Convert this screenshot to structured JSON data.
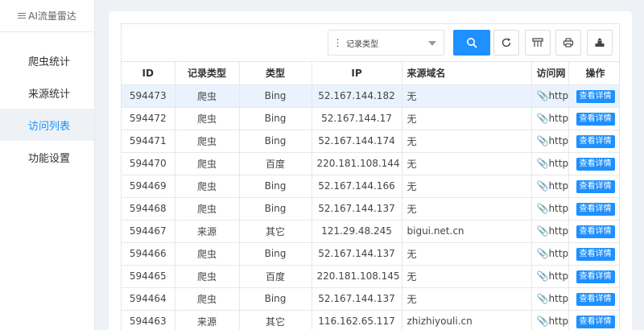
{
  "brand": {
    "title": "AI流量雷达"
  },
  "sidebar": {
    "items": [
      {
        "label": "爬虫统计",
        "active": false
      },
      {
        "label": "来源统计",
        "active": false
      },
      {
        "label": "访问列表",
        "active": true
      },
      {
        "label": "功能设置",
        "active": false
      }
    ]
  },
  "toolbar": {
    "select_value": "记录类型"
  },
  "table": {
    "columns": [
      "ID",
      "记录类型",
      "类型",
      "IP",
      "来源域名",
      "访问网",
      "操作"
    ],
    "detail_label": "查看详情",
    "url_prefix": "http",
    "rows": [
      {
        "id": "594473",
        "record_type": "爬虫",
        "type": "Bing",
        "ip": "52.167.144.182",
        "domain": "无"
      },
      {
        "id": "594472",
        "record_type": "爬虫",
        "type": "Bing",
        "ip": "52.167.144.17",
        "domain": "无"
      },
      {
        "id": "594471",
        "record_type": "爬虫",
        "type": "Bing",
        "ip": "52.167.144.174",
        "domain": "无"
      },
      {
        "id": "594470",
        "record_type": "爬虫",
        "type": "百度",
        "ip": "220.181.108.144",
        "domain": "无"
      },
      {
        "id": "594469",
        "record_type": "爬虫",
        "type": "Bing",
        "ip": "52.167.144.166",
        "domain": "无"
      },
      {
        "id": "594468",
        "record_type": "爬虫",
        "type": "Bing",
        "ip": "52.167.144.137",
        "domain": "无"
      },
      {
        "id": "594467",
        "record_type": "来源",
        "type": "其它",
        "ip": "121.29.48.245",
        "domain": "bigui.net.cn"
      },
      {
        "id": "594466",
        "record_type": "爬虫",
        "type": "Bing",
        "ip": "52.167.144.137",
        "domain": "无"
      },
      {
        "id": "594465",
        "record_type": "爬虫",
        "type": "百度",
        "ip": "220.181.108.145",
        "domain": "无"
      },
      {
        "id": "594464",
        "record_type": "爬虫",
        "type": "Bing",
        "ip": "52.167.144.137",
        "domain": "无"
      },
      {
        "id": "594463",
        "record_type": "来源",
        "type": "其它",
        "ip": "116.162.65.117",
        "domain": "zhizhiyouli.cn"
      }
    ]
  },
  "colors": {
    "accent": "#1e90ff",
    "active_bg": "#eef2f7",
    "highlight_row": "#eaf3fd"
  }
}
